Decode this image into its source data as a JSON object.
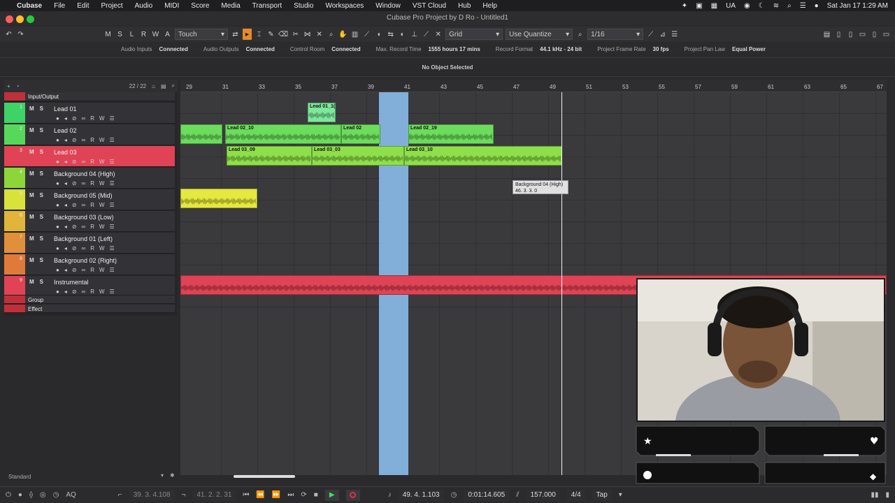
{
  "menubar": {
    "app": "Cubase",
    "items": [
      "File",
      "Edit",
      "Project",
      "Audio",
      "MIDI",
      "Score",
      "Media",
      "Transport",
      "Studio",
      "Workspaces",
      "Window",
      "VST Cloud",
      "Hub",
      "Help"
    ],
    "input_lang": "UA",
    "datetime": "Sat Jan 17  1:29 AM"
  },
  "window": {
    "title": "Cubase Pro Project by D Ro - Untitled1"
  },
  "toolbar": {
    "buttons": [
      "M",
      "S",
      "L",
      "R",
      "W",
      "A"
    ],
    "automation_mode": "Touch",
    "snap_type": "Grid",
    "quantize": "Use Quantize",
    "quantize_value": "1/16"
  },
  "status": {
    "audio_inputs_label": "Audio Inputs",
    "audio_inputs": "Connected",
    "audio_outputs_label": "Audio Outputs",
    "audio_outputs": "Connected",
    "control_room_label": "Control Room",
    "control_room": "Connected",
    "max_record_label": "Max. Record Time",
    "max_record": "1555 hours 17 mins",
    "record_format_label": "Record Format",
    "record_format": "44.1 kHz - 24 bit",
    "frame_rate_label": "Project Frame Rate",
    "frame_rate": "30 fps",
    "pan_law_label": "Project Pan Law",
    "pan_law": "Equal Power"
  },
  "info_line": "No Object Selected",
  "track_header": {
    "count": "22 / 22"
  },
  "tracks": [
    {
      "num": "",
      "name": "Input/Output",
      "color": "#c0303a",
      "type": "folder"
    },
    {
      "num": "1",
      "name": "Lead 01",
      "color": "#3fd267",
      "type": "audio"
    },
    {
      "num": "2",
      "name": "Lead 02",
      "color": "#57d85a",
      "type": "audio"
    },
    {
      "num": "3",
      "name": "Lead 03",
      "color": "#e04355",
      "type": "audio",
      "selected": true
    },
    {
      "num": "4",
      "name": "Background 04 (High)",
      "color": "#8dd63a",
      "type": "audio"
    },
    {
      "num": "5",
      "name": "Background 05 (Mid)",
      "color": "#d8e23a",
      "type": "audio"
    },
    {
      "num": "6",
      "name": "Background 03 (Low)",
      "color": "#e0b53a",
      "type": "audio"
    },
    {
      "num": "7",
      "name": "Background 01 (Left)",
      "color": "#e0903a",
      "type": "audio"
    },
    {
      "num": "8",
      "name": "Background 02 (Right)",
      "color": "#e07a3a",
      "type": "audio"
    },
    {
      "num": "9",
      "name": "Instrumental",
      "color": "#e04355",
      "type": "audio"
    },
    {
      "num": "",
      "name": "Group",
      "color": "#c0303a",
      "type": "folder"
    },
    {
      "num": "",
      "name": "Effect",
      "color": "#c0303a",
      "type": "folder"
    }
  ],
  "ruler": [
    "29",
    "31",
    "33",
    "35",
    "37",
    "39",
    "41",
    "43",
    "45",
    "47",
    "49",
    "51",
    "53",
    "55",
    "57",
    "59",
    "61",
    "63",
    "65",
    "67"
  ],
  "clips": [
    {
      "label": "Lead 01_1(",
      "color": "#7de89a"
    },
    {
      "label": "",
      "color": "#6cdc5c"
    },
    {
      "label": "Lead 02_10",
      "color": "#6cdc5c"
    },
    {
      "label": "Lead 02",
      "color": "#6cdc5c"
    },
    {
      "label": "Lead 02_19",
      "color": "#6cdc5c"
    },
    {
      "label": "Lead 03_09",
      "color": "#8ee04a"
    },
    {
      "label": "Lead 03_03",
      "color": "#8ee04a"
    },
    {
      "label": "Lead 03_10",
      "color": "#8ee04a"
    },
    {
      "label": "",
      "color": "#e5e83e"
    },
    {
      "label": "",
      "color": "#e04355"
    }
  ],
  "tooltip": {
    "line1": "Background 04 (High)",
    "line2": "46. 3. 3.  0"
  },
  "footer": {
    "workspace": "Standard"
  },
  "transport": {
    "left_locator": "39. 3. 4.108",
    "right_locator": "41. 2. 2. 31",
    "position_bars": "49. 4. 1.103",
    "position_time": "0:01:14.605",
    "tempo": "157.000",
    "signature": "4/4",
    "tap": "Tap",
    "aq": "AQ"
  }
}
